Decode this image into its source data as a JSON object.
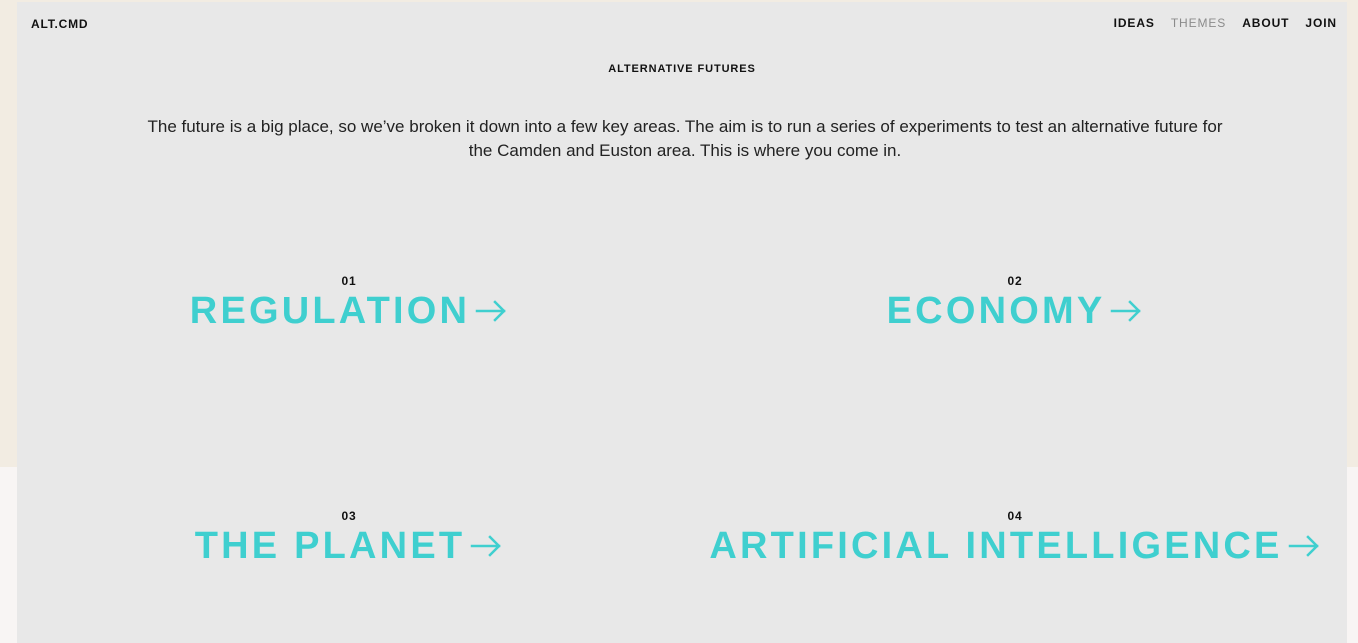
{
  "header": {
    "logo": "ALT.CMD",
    "nav": [
      {
        "label": "IDEAS",
        "state": "default"
      },
      {
        "label": "THEMES",
        "state": "current"
      },
      {
        "label": "ABOUT",
        "state": "default"
      },
      {
        "label": "JOIN",
        "state": "default"
      }
    ]
  },
  "hero": {
    "title": "ALTERNATIVE FUTURES",
    "intro": "The future is a big place, so we’ve broken it down into a few key areas. The aim is to run a series of experiments to test an alternative future for the Camden and Euston area. This is where you come in."
  },
  "themes": [
    {
      "number": "01",
      "label": "REGULATION",
      "icon": "arrow-right-icon"
    },
    {
      "number": "02",
      "label": "ECONOMY",
      "icon": "arrow-right-icon"
    },
    {
      "number": "03",
      "label": "THE PLANET",
      "icon": "arrow-right-icon"
    },
    {
      "number": "04",
      "label": "ARTIFICIAL INTELLIGENCE",
      "icon": "arrow-right-icon"
    }
  ],
  "colors": {
    "outer_background": "#f2ece2",
    "page_background": "#e8e8e8",
    "accent": "#3fcfcf",
    "text": "#111111",
    "muted_text": "#8b8b8b"
  }
}
